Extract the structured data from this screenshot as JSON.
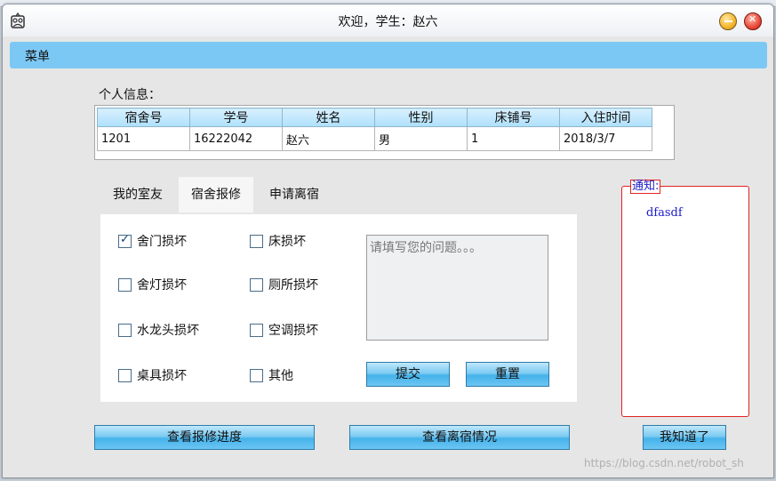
{
  "window": {
    "title": "欢迎，学生：赵六"
  },
  "menu": {
    "label": "菜单"
  },
  "info": {
    "label": "个人信息：",
    "columns": [
      "宿舍号",
      "学号",
      "姓名",
      "性别",
      "床铺号",
      "入住时间"
    ],
    "row": [
      "1201",
      "16222042",
      "赵六",
      "男",
      "1",
      "2018/3/7"
    ]
  },
  "tabs": [
    "我的室友",
    "宿舍报修",
    "申请离宿"
  ],
  "repair": {
    "options": [
      {
        "label": "舍门损坏",
        "checked": true
      },
      {
        "label": "床损坏",
        "checked": false
      },
      {
        "label": "舍灯损坏",
        "checked": false
      },
      {
        "label": "厕所损坏",
        "checked": false
      },
      {
        "label": "水龙头损坏",
        "checked": false
      },
      {
        "label": "空调损坏",
        "checked": false
      },
      {
        "label": "桌具损坏",
        "checked": false
      },
      {
        "label": "其他",
        "checked": false
      }
    ],
    "placeholder": "请填写您的问题。。。",
    "submit": "提交",
    "reset": "重置"
  },
  "buttons": {
    "view_repair": "查看报修进度",
    "view_leave": "查看离宿情况",
    "got_it": "我知道了"
  },
  "notice": {
    "title": "通知:",
    "content": "dfasdf"
  },
  "watermark": "https://blog.csdn.net/robot_sh",
  "colors": {
    "menubar": "#7cc8f4",
    "notice_border": "#e22424",
    "notice_text": "#1a1ac8"
  }
}
